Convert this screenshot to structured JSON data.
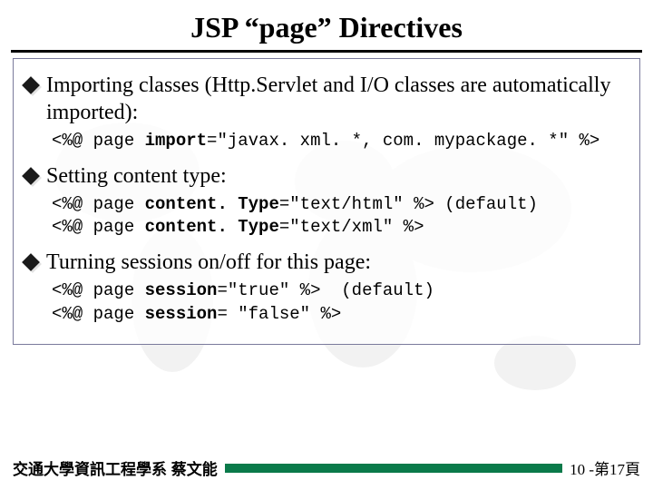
{
  "title": "JSP “page” Directives",
  "bullets": {
    "b1": "Importing classes (Http.Servlet and I/O classes are automatically imported):",
    "b2": "Setting content type:",
    "b3": "Turning sessions on/off for this page:"
  },
  "code": {
    "c1_open": "<%@ page ",
    "c1_kw": "import",
    "c1_rest": "=\"javax. xml. *, com. mypackage. *\" %>",
    "c2_open": "<%@ page ",
    "c2_kw": "content. Type",
    "c2_rest": "=\"text/html\" %> (default)",
    "c3_open": "<%@ page ",
    "c3_kw": "content. Type",
    "c3_rest": "=\"text/xml\" %>",
    "c4_open": "<%@ page ",
    "c4_kw": "session",
    "c4_rest": "=\"true\" %>  (default)",
    "c5_open": "<%@ page ",
    "c5_kw": "session",
    "c5_rest": "= \"false\" %>"
  },
  "footer": {
    "left": "交通大學資訊工程學系 蔡文能",
    "right": "10 -第17頁"
  }
}
